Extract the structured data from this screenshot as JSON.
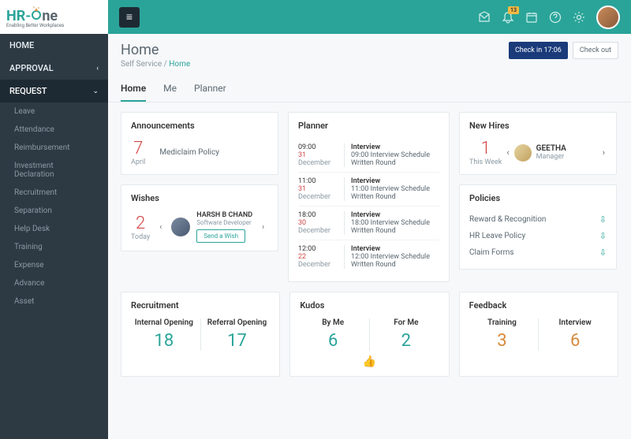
{
  "logo": {
    "part1": "HR-",
    "part2": "ne",
    "tagline": "Enabling Better Workplaces"
  },
  "nav": {
    "home": "HOME",
    "approval": "APPROVAL",
    "request": "REQUEST",
    "sub": [
      "Leave",
      "Attendance",
      "Reimbursement",
      "Investment Declaration",
      "Recruitment",
      "Separation",
      "Help Desk",
      "Training",
      "Expense",
      "Advance",
      "Asset"
    ]
  },
  "topbar": {
    "notification_badge": "13"
  },
  "page": {
    "title": "Home",
    "breadcrumb_base": "Self Service",
    "breadcrumb_current": "Home",
    "checkin_label": "Check in",
    "checkin_time": "17:06",
    "checkout_label": "Check out"
  },
  "tabs": [
    "Home",
    "Me",
    "Planner"
  ],
  "announcements": {
    "title": "Announcements",
    "date_num": "7",
    "date_month": "April",
    "text": "Mediclaim Policy"
  },
  "wishes": {
    "title": "Wishes",
    "date_num": "2",
    "date_label": "Today",
    "name": "HARSH B CHAND",
    "role": "Software Developer",
    "button": "Send a Wish"
  },
  "planner": {
    "title": "Planner",
    "items": [
      {
        "time": "09:00",
        "day": "31",
        "month": "December",
        "title": "Interview",
        "line2": "09:00 Interview Schedule",
        "line3": "Written Round"
      },
      {
        "time": "11:00",
        "day": "31",
        "month": "December",
        "title": "Interview",
        "line2": "11:00 Interview Schedule",
        "line3": "Written Round"
      },
      {
        "time": "18:00",
        "day": "30",
        "month": "December",
        "title": "Interview",
        "line2": "18:00 Interview Schedule",
        "line3": "Written Round"
      },
      {
        "time": "12:00",
        "day": "22",
        "month": "December",
        "title": "Interview",
        "line2": "12:00 Interview Schedule",
        "line3": "Written Round"
      }
    ]
  },
  "newhires": {
    "title": "New Hires",
    "count": "1",
    "period": "This Week",
    "name": "GEETHA",
    "role": "Manager"
  },
  "policies": {
    "title": "Policies",
    "items": [
      "Reward & Recognition",
      "HR Leave Policy",
      "Claim Forms"
    ]
  },
  "recruitment": {
    "title": "Recruitment",
    "internal_label": "Internal Opening",
    "internal_value": "18",
    "referral_label": "Referral Opening",
    "referral_value": "17"
  },
  "kudos": {
    "title": "Kudos",
    "byme_label": "By Me",
    "byme_value": "6",
    "forme_label": "For Me",
    "forme_value": "2"
  },
  "feedback": {
    "title": "Feedback",
    "training_label": "Training",
    "training_value": "3",
    "interview_label": "Interview",
    "interview_value": "6"
  }
}
